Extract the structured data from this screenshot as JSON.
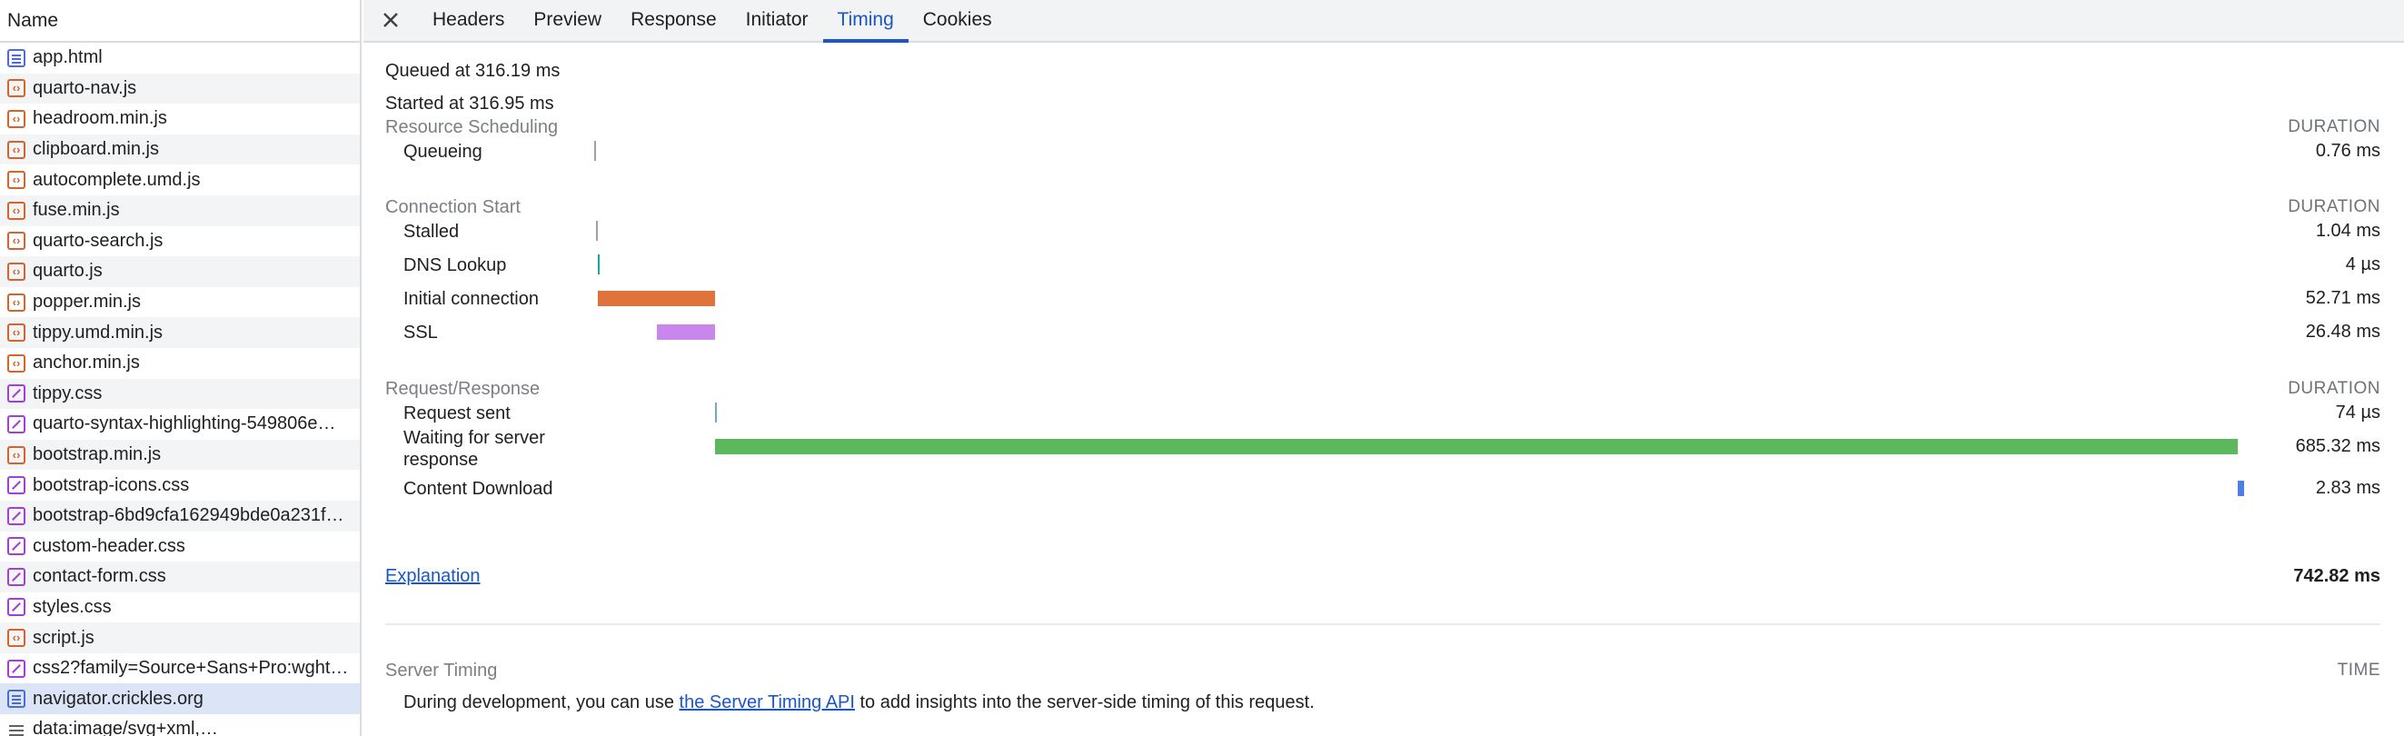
{
  "list": {
    "header": "Name",
    "items": [
      {
        "name": "app.html",
        "icon": "document-icon",
        "type": "doc"
      },
      {
        "name": "quarto-nav.js",
        "icon": "script-icon",
        "type": "script"
      },
      {
        "name": "headroom.min.js",
        "icon": "script-icon",
        "type": "script"
      },
      {
        "name": "clipboard.min.js",
        "icon": "script-icon",
        "type": "script"
      },
      {
        "name": "autocomplete.umd.js",
        "icon": "script-icon",
        "type": "script"
      },
      {
        "name": "fuse.min.js",
        "icon": "script-icon",
        "type": "script"
      },
      {
        "name": "quarto-search.js",
        "icon": "script-icon",
        "type": "script"
      },
      {
        "name": "quarto.js",
        "icon": "script-icon",
        "type": "script"
      },
      {
        "name": "popper.min.js",
        "icon": "script-icon",
        "type": "script"
      },
      {
        "name": "tippy.umd.min.js",
        "icon": "script-icon",
        "type": "script"
      },
      {
        "name": "anchor.min.js",
        "icon": "script-icon",
        "type": "script"
      },
      {
        "name": "tippy.css",
        "icon": "stylesheet-icon",
        "type": "style"
      },
      {
        "name": "quarto-syntax-highlighting-549806e…",
        "icon": "stylesheet-icon",
        "type": "style"
      },
      {
        "name": "bootstrap.min.js",
        "icon": "script-icon",
        "type": "script"
      },
      {
        "name": "bootstrap-icons.css",
        "icon": "stylesheet-icon",
        "type": "style"
      },
      {
        "name": "bootstrap-6bd9cfa162949bde0a231f…",
        "icon": "stylesheet-icon",
        "type": "style"
      },
      {
        "name": "custom-header.css",
        "icon": "stylesheet-icon",
        "type": "style"
      },
      {
        "name": "contact-form.css",
        "icon": "stylesheet-icon",
        "type": "style"
      },
      {
        "name": "styles.css",
        "icon": "stylesheet-icon",
        "type": "style"
      },
      {
        "name": "script.js",
        "icon": "script-icon",
        "type": "script"
      },
      {
        "name": "css2?family=Source+Sans+Pro:wght…",
        "icon": "stylesheet-icon",
        "type": "style"
      },
      {
        "name": "navigator.crickles.org",
        "icon": "document-icon",
        "type": "doc",
        "selected": true
      },
      {
        "name": "data:image/svg+xml,…",
        "icon": "other-icon",
        "type": "other"
      }
    ]
  },
  "tabs": [
    {
      "label": "Headers"
    },
    {
      "label": "Preview"
    },
    {
      "label": "Response"
    },
    {
      "label": "Initiator"
    },
    {
      "label": "Timing",
      "active": true
    },
    {
      "label": "Cookies"
    }
  ],
  "timing": {
    "queued_at": "Queued at 316.19 ms",
    "started_at": "Started at 316.95 ms",
    "duration_heading": "DURATION",
    "sections": [
      {
        "title": "Resource Scheduling",
        "rows": [
          {
            "label": "Queueing",
            "value": "0.76 ms",
            "start_ms": 0,
            "duration_ms": 0.76,
            "color": "#9aa0a6"
          }
        ]
      },
      {
        "title": "Connection Start",
        "rows": [
          {
            "label": "Stalled",
            "value": "1.04 ms",
            "start_ms": 0.76,
            "duration_ms": 1.04,
            "color": "#9aa0a6"
          },
          {
            "label": "DNS Lookup",
            "value": "4 µs",
            "start_ms": 1.8,
            "duration_ms": 0.004,
            "color": "#1aa3a3"
          },
          {
            "label": "Initial connection",
            "value": "52.71 ms",
            "start_ms": 1.81,
            "duration_ms": 52.71,
            "color": "#e0733c"
          },
          {
            "label": "SSL",
            "value": "26.48 ms",
            "start_ms": 28.04,
            "duration_ms": 26.48,
            "color": "#c987ee"
          }
        ]
      },
      {
        "title": "Request/Response",
        "rows": [
          {
            "label": "Request sent",
            "value": "74 µs",
            "start_ms": 54.52,
            "duration_ms": 0.074,
            "color": "#6fa8dc"
          },
          {
            "label": "Waiting for server response",
            "value": "685.32 ms",
            "start_ms": 54.6,
            "duration_ms": 685.32,
            "color": "#5cb85c"
          },
          {
            "label": "Content Download",
            "value": "2.83 ms",
            "start_ms": 739.92,
            "duration_ms": 2.83,
            "color": "#4d7ee8"
          }
        ]
      }
    ],
    "explanation_link": "Explanation",
    "total": "742.82 ms",
    "total_ms": 742.82,
    "server_timing": {
      "title": "Server Timing",
      "heading": "TIME",
      "text_before": "During development, you can use ",
      "link": "the Server Timing API",
      "text_after": " to add insights into the server-side timing of this request."
    }
  }
}
